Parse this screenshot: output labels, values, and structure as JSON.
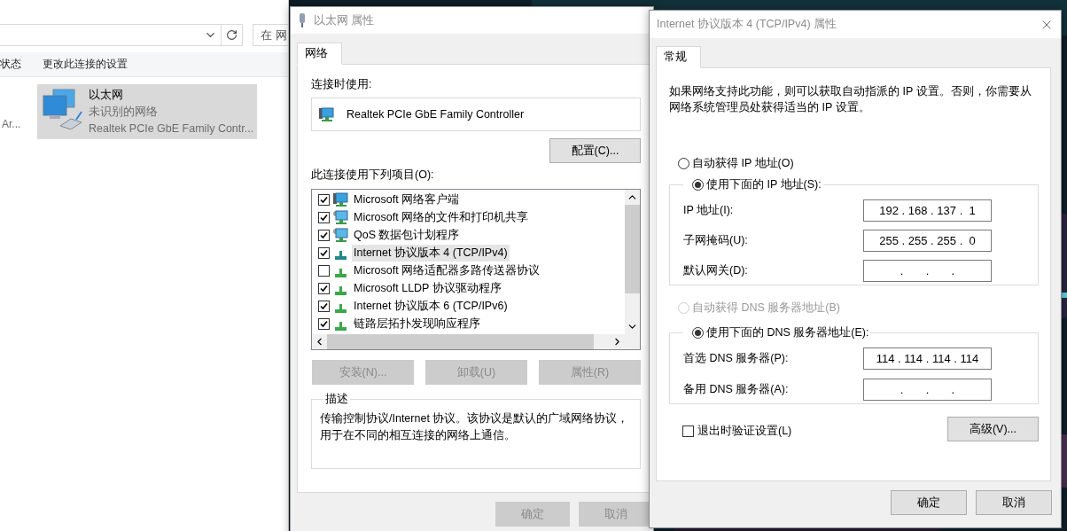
{
  "explorer": {
    "search": {
      "placeholder": "在 网"
    },
    "toolbar": [
      "状态",
      "更改此连接的设置"
    ],
    "connections": [
      {
        "device": "Ar...",
        "selected": false
      },
      {
        "name": "以太网",
        "status": "未识别的网络",
        "device": "Realtek PCIe GbE Family Contr...",
        "selected": true
      }
    ]
  },
  "ethernet_dialog": {
    "title": "以太网 属性",
    "tabs": [
      {
        "label": "网络",
        "selected": true
      }
    ],
    "connect_using_label": "连接时使用:",
    "adapter": "Realtek PCIe GbE Family Controller",
    "configure_button": "配置(C)...",
    "components_label": "此连接使用下列项目(O):",
    "components": [
      {
        "kind": "client",
        "label": "Microsoft 网络客户端",
        "checked": true,
        "selected": false
      },
      {
        "kind": "service",
        "label": "Microsoft 网络的文件和打印机共享",
        "checked": true,
        "selected": false
      },
      {
        "kind": "service",
        "label": "QoS 数据包计划程序",
        "checked": true,
        "selected": false
      },
      {
        "kind": "protocol",
        "label": "Internet 协议版本 4 (TCP/IPv4)",
        "checked": true,
        "selected": true
      },
      {
        "kind": "protocol",
        "label": "Microsoft 网络适配器多路传送器协议",
        "checked": false,
        "selected": false
      },
      {
        "kind": "protocol",
        "label": "Microsoft LLDP 协议驱动程序",
        "checked": true,
        "selected": false
      },
      {
        "kind": "protocol",
        "label": "Internet 协议版本 6 (TCP/IPv6)",
        "checked": true,
        "selected": false
      },
      {
        "kind": "protocol",
        "label": "链路层拓扑发现响应程序",
        "checked": true,
        "selected": false
      }
    ],
    "component_buttons": [
      {
        "label": "安装(N)...",
        "disabled": true
      },
      {
        "label": "卸载(U)",
        "disabled": true
      },
      {
        "label": "属性(R)",
        "disabled": true
      }
    ],
    "description": {
      "title": "描述",
      "text": "传输控制协议/Internet 协议。该协议是默认的广域网络协议，用于在不同的相互连接的网络上通信。"
    },
    "footer_buttons": [
      {
        "label": "确定",
        "disabled": true
      },
      {
        "label": "取消",
        "disabled": true
      }
    ]
  },
  "ipv4_dialog": {
    "title": "Internet 协议版本 4 (TCP/IPv4) 属性",
    "tabs": [
      {
        "label": "常规",
        "selected": true
      }
    ],
    "intro": "如果网络支持此功能，则可以获取自动指派的 IP 设置。否则，你需要从网络系统管理员处获得适当的 IP 设置。",
    "ip_auto": {
      "label": "自动获得 IP 地址(O)",
      "selected": false,
      "disabled": false
    },
    "ip_manual": {
      "label": "使用下面的 IP 地址(S):",
      "selected": true,
      "disabled": false
    },
    "ip_fields": [
      {
        "label": "IP 地址(I):",
        "value": "192 . 168 . 137 .  1"
      },
      {
        "label": "子网掩码(U):",
        "value": "255 . 255 . 255 .  0"
      },
      {
        "label": "默认网关(D):",
        "value": ".       .       ."
      }
    ],
    "dns_auto": {
      "label": "自动获得 DNS 服务器地址(B)",
      "selected": false,
      "disabled": true
    },
    "dns_manual": {
      "label": "使用下面的 DNS 服务器地址(E):",
      "selected": true,
      "disabled": false
    },
    "dns_fields": [
      {
        "label": "首选 DNS 服务器(P):",
        "value": "114 . 114 . 114 . 114"
      },
      {
        "label": "备用 DNS 服务器(A):",
        "value": ".       .       ."
      }
    ],
    "validate": {
      "label": "退出时验证设置(L)",
      "checked": false
    },
    "advanced_button": "高级(V)...",
    "footer_buttons": [
      {
        "label": "确定",
        "disabled": false
      },
      {
        "label": "取消",
        "disabled": false
      }
    ]
  }
}
